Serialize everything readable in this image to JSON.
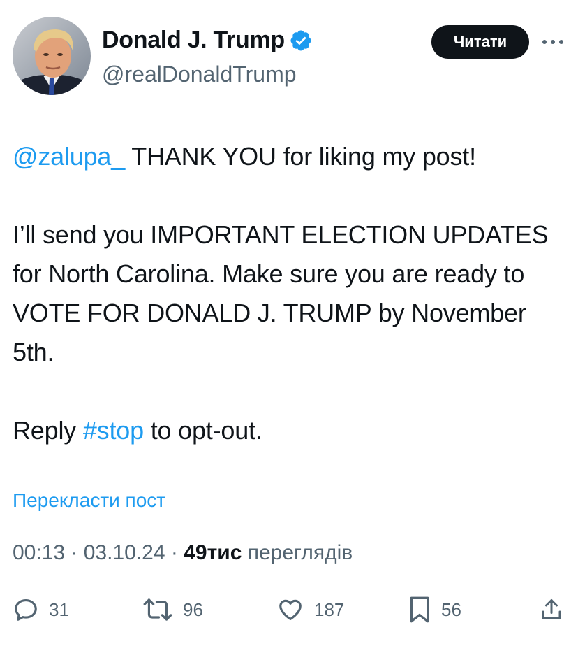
{
  "author": {
    "name": "Donald J. Trump",
    "handle": "@realDonaldTrump",
    "verified": true,
    "avatar": "profile-photo"
  },
  "follow_button": {
    "label": "Читати"
  },
  "more_icon": "more-horizontal-icon",
  "tweet": {
    "mention": "@zalupa_",
    "line1_rest": " THANK YOU for liking my post!",
    "paragraph2": "I’ll send you IMPORTANT ELECTION UPDATES for North Carolina. Make sure you are ready to VOTE FOR DONALD J. TRUMP by November 5th.",
    "reply_prefix": "Reply ",
    "hashtag": "#stop",
    "reply_suffix": " to opt-out."
  },
  "translate_label": "Перекласти пост",
  "meta": {
    "time": "00:13",
    "separator": " · ",
    "date": "03.10.24",
    "views_count": "49тис",
    "views_label": " переглядів"
  },
  "actions": {
    "replies": {
      "icon": "reply-icon",
      "count": "31"
    },
    "reposts": {
      "icon": "repost-icon",
      "count": "96"
    },
    "likes": {
      "icon": "heart-icon",
      "count": "187"
    },
    "bookmarks": {
      "icon": "bookmark-icon",
      "count": "56"
    },
    "share": {
      "icon": "share-icon"
    }
  },
  "colors": {
    "text": "#0f1419",
    "secondary": "#536471",
    "link": "#1d9bf0",
    "button_bg": "#0f1419",
    "button_text": "#ffffff",
    "verified": "#1d9bf0"
  }
}
